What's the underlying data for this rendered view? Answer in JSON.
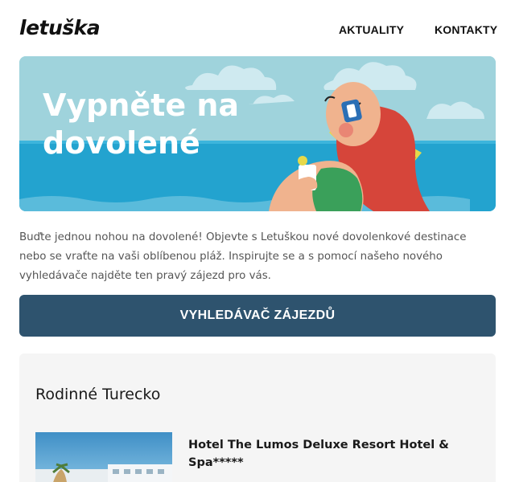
{
  "header": {
    "logo": "letuška",
    "nav": [
      "AKTUALITY",
      "KONTAKTY"
    ]
  },
  "hero": {
    "title_line1": "Vypněte na",
    "title_line2": "dovolené"
  },
  "intro": {
    "text": "Buďte jednou nohou na dovolené! Objevte s Letuškou nové dovolenkové destinace nebo se vraťte na vaši oblíbenou pláž. Inspirujte se a s pomocí našeho nového vyhledávače najděte ten pravý zájezd pro vás."
  },
  "cta": {
    "label": "VYHLEDÁVAČ ZÁJEZDŮ"
  },
  "section": {
    "title": "Rodinné Turecko",
    "hotel": {
      "name": "Hotel The Lumos Deluxe Resort Hotel & Spa*****"
    }
  },
  "colors": {
    "cta_bg": "#2e536e",
    "sky": "#9fd3dc",
    "sea": "#23a3cf",
    "logo_accent": "#e8452c"
  }
}
